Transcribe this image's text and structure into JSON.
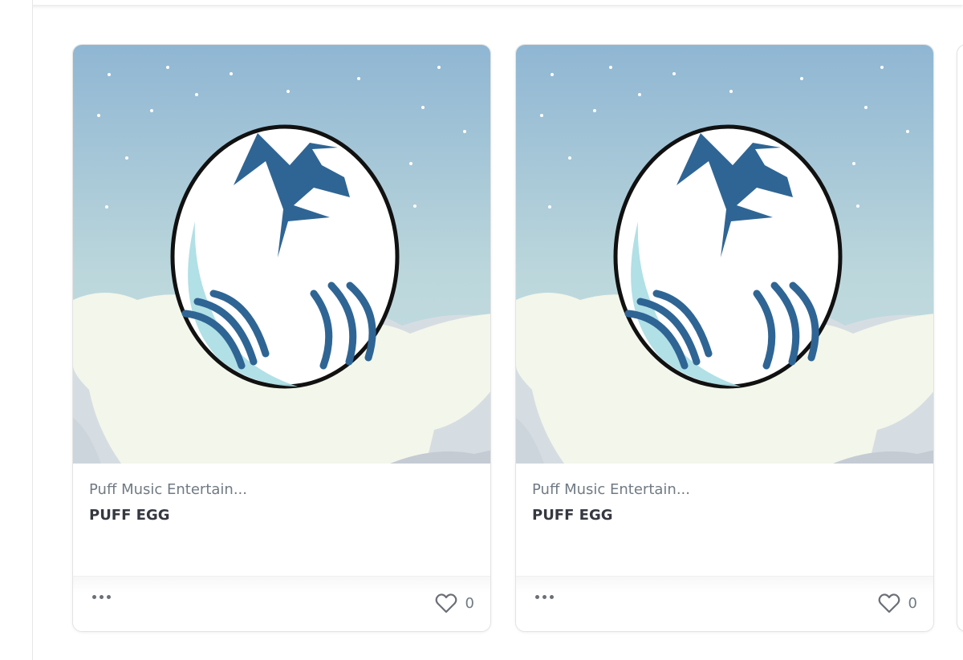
{
  "cards": [
    {
      "collection": "Puff Music Entertain...",
      "title": "PUFF EGG",
      "likes": "0",
      "image_icon": "dragon-egg-image"
    },
    {
      "collection": "Puff Music Entertain...",
      "title": "PUFF EGG",
      "likes": "0",
      "image_icon": "dragon-egg-image"
    }
  ],
  "icons": {
    "more": "more-options-icon",
    "like": "heart-icon"
  },
  "colors": {
    "sky_top": "#8fb6d3",
    "sky_bottom": "#c7dfe3",
    "egg_marking": "#2f6594",
    "cloud": "#f3f6ea",
    "text_muted": "#707a83",
    "text_title": "#353840"
  }
}
